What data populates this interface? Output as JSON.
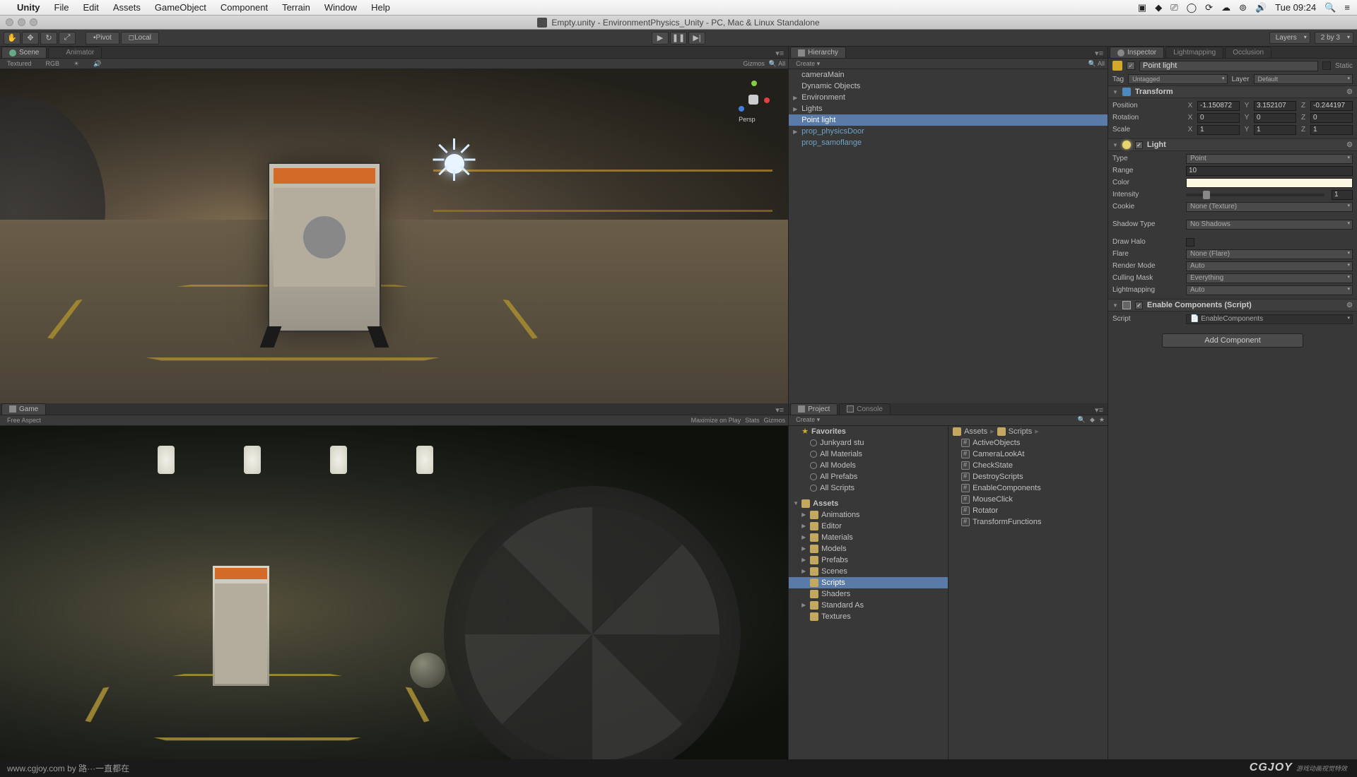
{
  "mac_menu": {
    "app": "Unity",
    "items": [
      "File",
      "Edit",
      "Assets",
      "GameObject",
      "Component",
      "Terrain",
      "Window",
      "Help"
    ],
    "clock": "Tue 09:24"
  },
  "window_title": "Empty.unity - EnvironmentPhysics_Unity - PC, Mac & Linux Standalone",
  "toolbar": {
    "pivot": "Pivot",
    "local": "Local",
    "layers": "Layers",
    "layout": "2 by 3"
  },
  "scene_tab": "Scene",
  "animator_tab": "Animator",
  "scene_bar": {
    "shading": "Textured",
    "render": "RGB",
    "gizmos": "Gizmos",
    "all": "All",
    "persp": "Persp"
  },
  "game_tab": "Game",
  "game_bar": {
    "aspect": "Free Aspect",
    "max": "Maximize on Play",
    "stats": "Stats",
    "gizmos": "Gizmos"
  },
  "hierarchy": {
    "tab": "Hierarchy",
    "create": "Create",
    "search_ph": "All",
    "items": [
      {
        "label": "cameraMain"
      },
      {
        "label": "Dynamic Objects"
      },
      {
        "label": "Environment",
        "expandable": true
      },
      {
        "label": "Lights",
        "expandable": true
      },
      {
        "label": "Point light",
        "selected": true
      },
      {
        "label": "prop_physicsDoor",
        "linked": true,
        "expandable": true
      },
      {
        "label": "prop_samoflange",
        "linked": true
      }
    ]
  },
  "project": {
    "tab": "Project",
    "console_tab": "Console",
    "create": "Create",
    "breadcrumb": [
      "Assets",
      "Scripts"
    ],
    "favorites_label": "Favorites",
    "favorites": [
      "Junkyard stu",
      "All Materials",
      "All Models",
      "All Prefabs",
      "All Scripts"
    ],
    "assets_label": "Assets",
    "folders": [
      "Animations",
      "Editor",
      "Materials",
      "Models",
      "Prefabs",
      "Scenes",
      "Scripts",
      "Shaders",
      "Standard As",
      "Textures"
    ],
    "selected_folder": "Scripts",
    "scripts": [
      "ActiveObjects",
      "CameraLookAt",
      "CheckState",
      "DestroyScripts",
      "EnableComponents",
      "MouseClick",
      "Rotator",
      "TransformFunctions"
    ]
  },
  "inspector": {
    "tab": "Inspector",
    "lightmapping_tab": "Lightmapping",
    "occlusion_tab": "Occlusion",
    "name": "Point light",
    "static": "Static",
    "tag_label": "Tag",
    "tag_value": "Untagged",
    "layer_label": "Layer",
    "layer_value": "Default",
    "transform": {
      "title": "Transform",
      "position_label": "Position",
      "rotation_label": "Rotation",
      "scale_label": "Scale",
      "pos": {
        "x": "-1.150872",
        "y": "3.152107",
        "z": "-0.244197"
      },
      "rot": {
        "x": "0",
        "y": "0",
        "z": "0"
      },
      "scale": {
        "x": "1",
        "y": "1",
        "z": "1"
      }
    },
    "light": {
      "title": "Light",
      "type_label": "Type",
      "type_value": "Point",
      "range_label": "Range",
      "range_value": "10",
      "color_label": "Color",
      "color_value": "#fdf6e0",
      "intensity_label": "Intensity",
      "intensity_value": "1",
      "cookie_label": "Cookie",
      "cookie_value": "None (Texture)",
      "shadow_label": "Shadow Type",
      "shadow_value": "No Shadows",
      "halo_label": "Draw Halo",
      "flare_label": "Flare",
      "flare_value": "None (Flare)",
      "render_label": "Render Mode",
      "render_value": "Auto",
      "culling_label": "Culling Mask",
      "culling_value": "Everything",
      "lightmap_label": "Lightmapping",
      "lightmap_value": "Auto"
    },
    "script_comp": {
      "title": "Enable Components (Script)",
      "script_label": "Script",
      "script_value": "EnableComponents"
    },
    "add_component": "Add Component"
  },
  "footer": {
    "text": "www.cgjoy.com by 路···一直都在",
    "logo": "CGJOY"
  }
}
